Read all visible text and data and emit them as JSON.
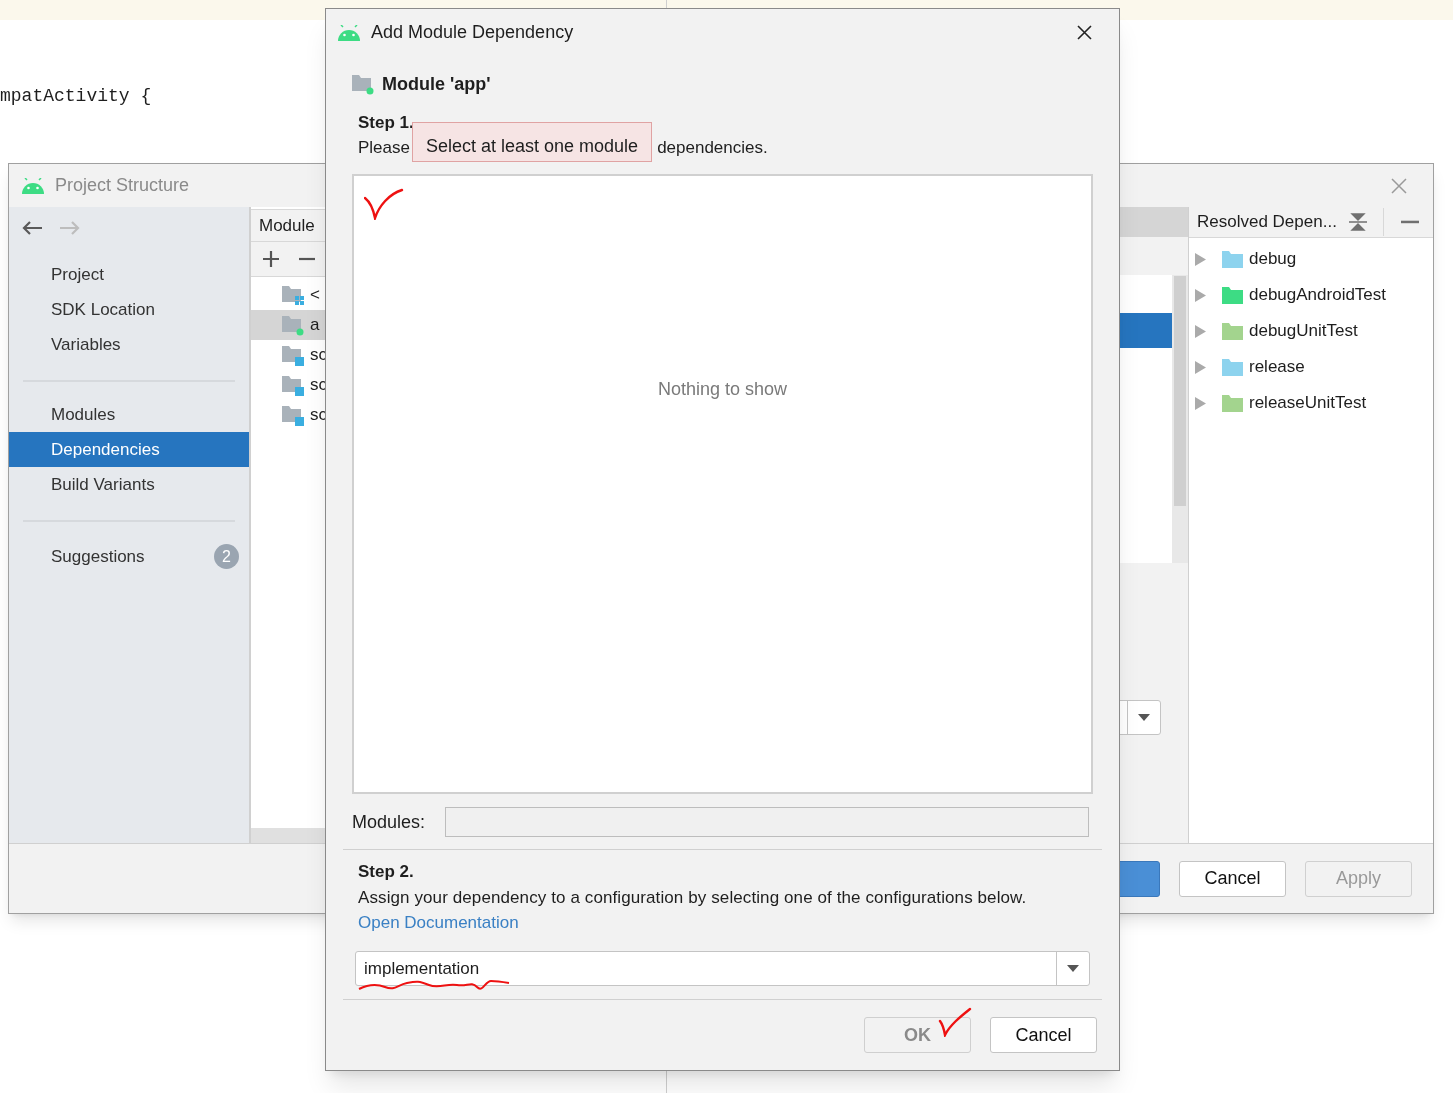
{
  "editor": {
    "code_line": "mpatActivity {"
  },
  "project_structure": {
    "title": "Project Structure",
    "navigation": {
      "back_enabled": true,
      "forward_enabled": false
    },
    "sections": [
      {
        "items": [
          {
            "label": "Project",
            "selected": false
          },
          {
            "label": "SDK Location",
            "selected": false
          },
          {
            "label": "Variables",
            "selected": false
          }
        ]
      },
      {
        "items": [
          {
            "label": "Modules",
            "selected": false
          },
          {
            "label": "Dependencies",
            "selected": true
          },
          {
            "label": "Build Variants",
            "selected": false
          }
        ]
      }
    ],
    "suggestions": {
      "label": "Suggestions",
      "count": "2"
    },
    "modules_panel": {
      "header": "Module",
      "items": [
        {
          "label": "<",
          "kind": "grid",
          "selected": false
        },
        {
          "label": "a",
          "kind": "app",
          "selected": true
        },
        {
          "label": "sc",
          "kind": "lib",
          "selected": false
        },
        {
          "label": "sc",
          "kind": "lib",
          "selected": false
        },
        {
          "label": "sc",
          "kind": "lib",
          "selected": false
        }
      ]
    },
    "resolved_panel": {
      "header": "Resolved Depen...",
      "items": [
        {
          "label": "debug",
          "color": "#8dd3ee"
        },
        {
          "label": "debugAndroidTest",
          "color": "#3ddc84"
        },
        {
          "label": "debugUnitTest",
          "color": "#a3d48e"
        },
        {
          "label": "release",
          "color": "#8dd3ee"
        },
        {
          "label": "releaseUnitTest",
          "color": "#a3d48e"
        }
      ]
    },
    "buttons": [
      {
        "label": "Cancel",
        "disabled": false
      },
      {
        "label": "Apply",
        "disabled": true
      }
    ]
  },
  "dialog": {
    "title": "Add Module Dependency",
    "module": "Module 'app'",
    "step1": {
      "heading": "Step 1.",
      "text_before": "Please",
      "tooltip": "Select at least one module",
      "text_after": "dependencies.",
      "empty_text": "Nothing to show"
    },
    "modules_label": "Modules:",
    "step2": {
      "heading": "Step 2.",
      "description": "Assign your dependency to a configuration by selecting one of the configurations below.",
      "link": "Open Documentation",
      "configuration": "implementation"
    },
    "buttons": [
      {
        "label": "OK",
        "disabled": true
      },
      {
        "label": "Cancel",
        "disabled": false
      }
    ]
  }
}
